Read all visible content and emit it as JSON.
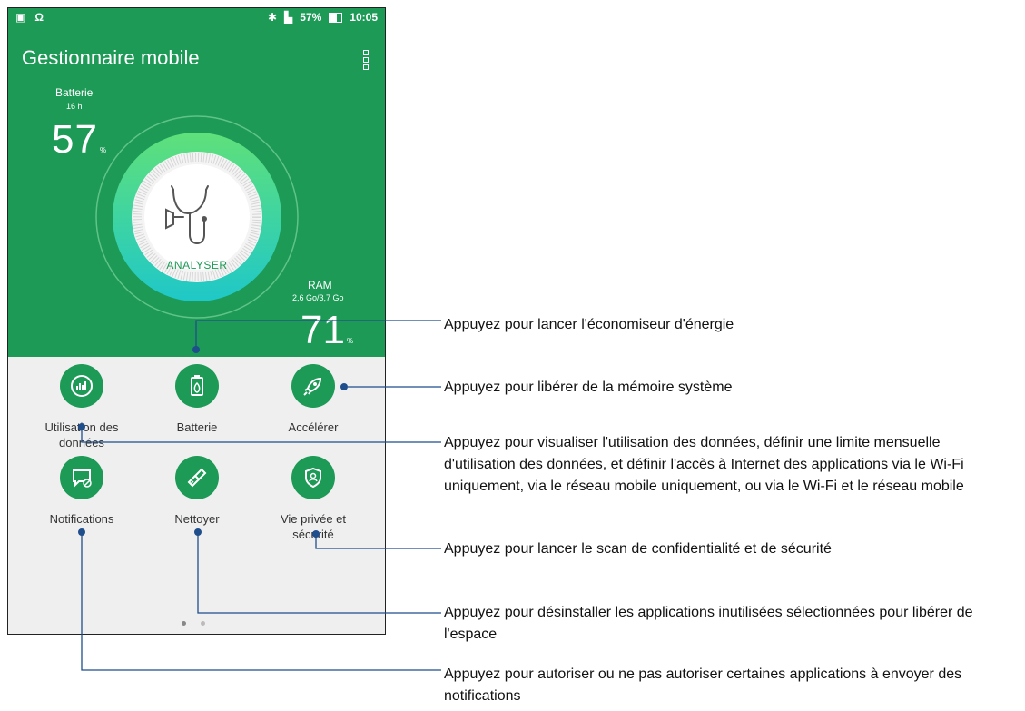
{
  "status_bar": {
    "battery": "57%",
    "time": "10:05"
  },
  "app": {
    "title": "Gestionnaire mobile"
  },
  "battery": {
    "label": "Batterie",
    "hours": "16 h",
    "percent": "57",
    "unit": "%"
  },
  "ram": {
    "label": "RAM",
    "usage": "2,6 Go/3,7 Go",
    "percent": "71",
    "unit": "%"
  },
  "analyser": {
    "label": "ANALYSER"
  },
  "tools": [
    {
      "label": "Utilisation des données",
      "icon": "chart-icon"
    },
    {
      "label": "Batterie",
      "icon": "battery-leaf-icon"
    },
    {
      "label": "Accélérer",
      "icon": "rocket-icon"
    },
    {
      "label": "Notifications",
      "icon": "notification-block-icon"
    },
    {
      "label": "Nettoyer",
      "icon": "broom-icon"
    },
    {
      "label": "Vie privée et sécurité",
      "icon": "shield-user-icon"
    }
  ],
  "callouts": [
    "Appuyez pour lancer l'économiseur d'énergie",
    "Appuyez pour libérer de la mémoire système",
    "Appuyez pour visualiser l'utilisation des données, définir une limite mensuelle d'utilisation des données, et définir l'accès à Internet des applications via le Wi-Fi uniquement, via le réseau mobile uniquement, ou via le Wi-Fi et le réseau mobile",
    "Appuyez pour lancer le scan de confidentialité et de sécurité",
    "Appuyez pour désinstaller les applications inutilisées sélectionnées pour libérer de l'espace",
    "Appuyez pour autoriser ou ne pas autoriser certaines applications à envoyer des notifications"
  ],
  "colors": {
    "primary_green": "#1c9a56",
    "gauge_light": "#5fe07a",
    "gauge_teal": "#1fc8c8",
    "callout_line": "#1f4e8c"
  }
}
